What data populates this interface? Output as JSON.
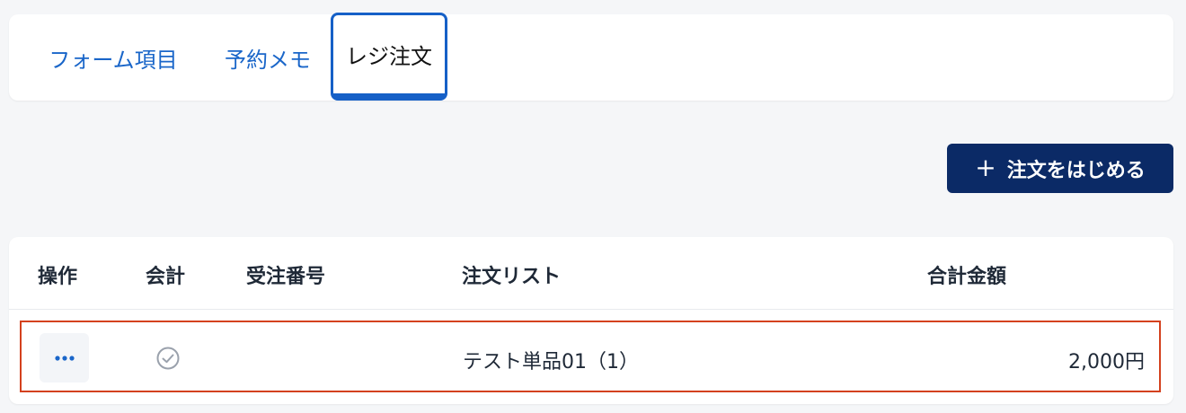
{
  "tabs": [
    {
      "label": "フォーム項目",
      "active": false
    },
    {
      "label": "予約メモ",
      "active": false
    },
    {
      "label": "レジ注文",
      "active": true
    }
  ],
  "actions": {
    "start_order_label": "注文をはじめる",
    "start_order_icon": "plus-icon"
  },
  "table": {
    "headers": {
      "operations": "操作",
      "payment": "会計",
      "order_number": "受注番号",
      "order_list": "注文リスト",
      "total": "合計金額"
    },
    "rows": [
      {
        "menu_icon": "more-dots-icon",
        "payment_icon": "check-circle-icon",
        "order_number": "",
        "order_list": "テスト単品01（1）",
        "total": "2,000円"
      }
    ]
  },
  "colors": {
    "accent": "#1a66c9",
    "primary_button": "#0b2a66",
    "highlight_border": "#d4411e",
    "background": "#f5f6f8"
  }
}
